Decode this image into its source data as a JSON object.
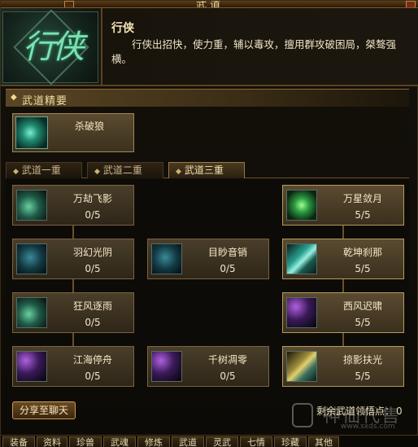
{
  "window": {
    "title": "武道"
  },
  "header": {
    "emblem_text": "行侠",
    "title": "行侠",
    "description": "行侠出招快，使力重，辅以毒攻，擅用群攻破困局，桀骜强横。"
  },
  "essence_section": {
    "label": "武道精要",
    "skill_name": "杀破狼"
  },
  "tabs": [
    {
      "label": "武道一重",
      "active": false
    },
    {
      "label": "武道二重",
      "active": false
    },
    {
      "label": "武道三重",
      "active": true
    }
  ],
  "skills": [
    {
      "name": "万劫飞影",
      "count": "0/5",
      "icon": "green-beast-icon"
    },
    {
      "name": "万星敛月",
      "count": "5/5",
      "icon": "neon-star-icon"
    },
    {
      "name": "羽幻光阴",
      "count": "0/5",
      "icon": "blue-swirl-icon"
    },
    {
      "name": "目眇音销",
      "count": "0/5",
      "icon": "blue-serpent-icon"
    },
    {
      "name": "乾坤刹那",
      "count": "5/5",
      "icon": "teal-blade-icon"
    },
    {
      "name": "狂风逐雨",
      "count": "0/5",
      "icon": "green-wind-icon"
    },
    {
      "name": "西风迟啸",
      "count": "5/5",
      "icon": "purple-wave-icon"
    },
    {
      "name": "江海停舟",
      "count": "0/5",
      "icon": "purple-boat-icon"
    },
    {
      "name": "千树凋零",
      "count": "0/5",
      "icon": "purple-branch-icon"
    },
    {
      "name": "掠影扶光",
      "count": "5/5",
      "icon": "gold-blade-icon"
    }
  ],
  "footer": {
    "share_label": "分享至聊天",
    "remaining_label": "剩余武道领悟点：",
    "remaining_value": "0"
  },
  "watermark": {
    "text": "神仙代售",
    "url": "www.sxds.com"
  },
  "bottom_tabs": [
    "装备",
    "资料",
    "珍兽",
    "武魂",
    "修炼",
    "武道",
    "灵武",
    "七情",
    "珍藏",
    "其他"
  ],
  "colors": {
    "accent": "#c89a58",
    "panel": "#3a301e",
    "text": "#f4e8c8"
  }
}
